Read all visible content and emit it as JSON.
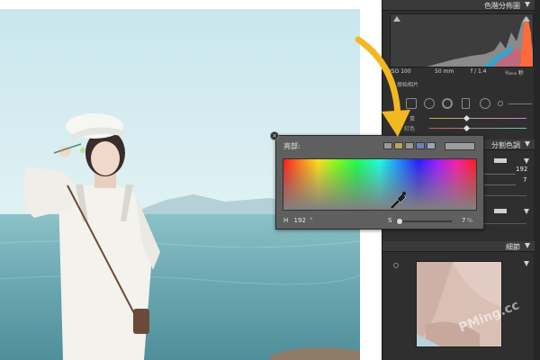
{
  "histogram": {
    "title": "色階分佈圖",
    "iso": "ISO 100",
    "focal": "50 mm",
    "aperture": "f / 1.4",
    "shutter": "¹⁄₄₀₀₀ 秒",
    "original_photo_label": "原始相片"
  },
  "adjust_rows": {
    "row1": "黃",
    "row2": "紅色"
  },
  "split_toning": {
    "title": "分割色調",
    "hue_value": "192",
    "sat_value": "7"
  },
  "detail": {
    "title": "細節"
  },
  "popup": {
    "label": "亮部:",
    "h_label": "H",
    "h_value": "192",
    "s_label": "S",
    "s_value": "7",
    "s_fraction": 0.07,
    "swatches": [
      "#9a9a9a",
      "#b8a15a",
      "#9b9a8a",
      "#6a82b8",
      "#9aa4b8"
    ]
  },
  "watermark": "PMing.cc",
  "colors": {
    "accent_arrow": "#f2b821",
    "panel_bg": "#2f2f2f",
    "popup_bg": "#5f5f5f"
  }
}
